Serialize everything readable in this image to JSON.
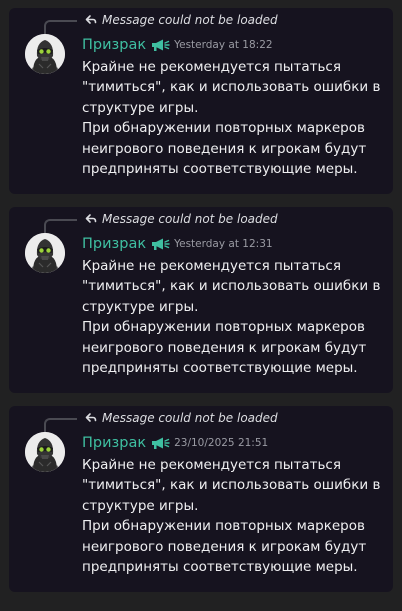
{
  "colors": {
    "page_background": "#212122",
    "card_background": "#16131f",
    "username": "#3fbfa1",
    "body_text": "#efeff1",
    "timestamp": "#9a9ba3"
  },
  "messages": [
    {
      "reply_icon": "reply-arrow-icon",
      "reply_text": "Message could not be loaded",
      "username": "Призрак",
      "role_icon": "megaphone-icon",
      "timestamp": "Yesterday at 18:22",
      "paragraph_1": "Крайне не рекомендуется пытаться \"тимиться\", как и использовать ошибки в структуре игры.",
      "paragraph_2": "При обнаружении повторных маркеров неигрового поведения к игрокам будут предприняты соответствующие меры."
    },
    {
      "reply_icon": "reply-arrow-icon",
      "reply_text": "Message could not be loaded",
      "username": "Призрак",
      "role_icon": "megaphone-icon",
      "timestamp": "Yesterday at 12:31",
      "paragraph_1": "Крайне не рекомендуется пытаться \"тимиться\", как и использовать ошибки в структуре игры.",
      "paragraph_2": "При обнаружении повторных маркеров неигрового поведения к игрокам будут предприняты соответствующие меры."
    },
    {
      "reply_icon": "reply-arrow-icon",
      "reply_text": "Message could not be loaded",
      "username": "Призрак",
      "role_icon": "megaphone-icon",
      "timestamp": "23/10/2025 21:51",
      "paragraph_1": "Крайне не рекомендуется пытаться \"тимиться\", как и использовать ошибки в структуре игры.",
      "paragraph_2": "При обнаружении повторных маркеров неигрового поведения к игрокам будут предприняты соответствующие меры."
    }
  ]
}
